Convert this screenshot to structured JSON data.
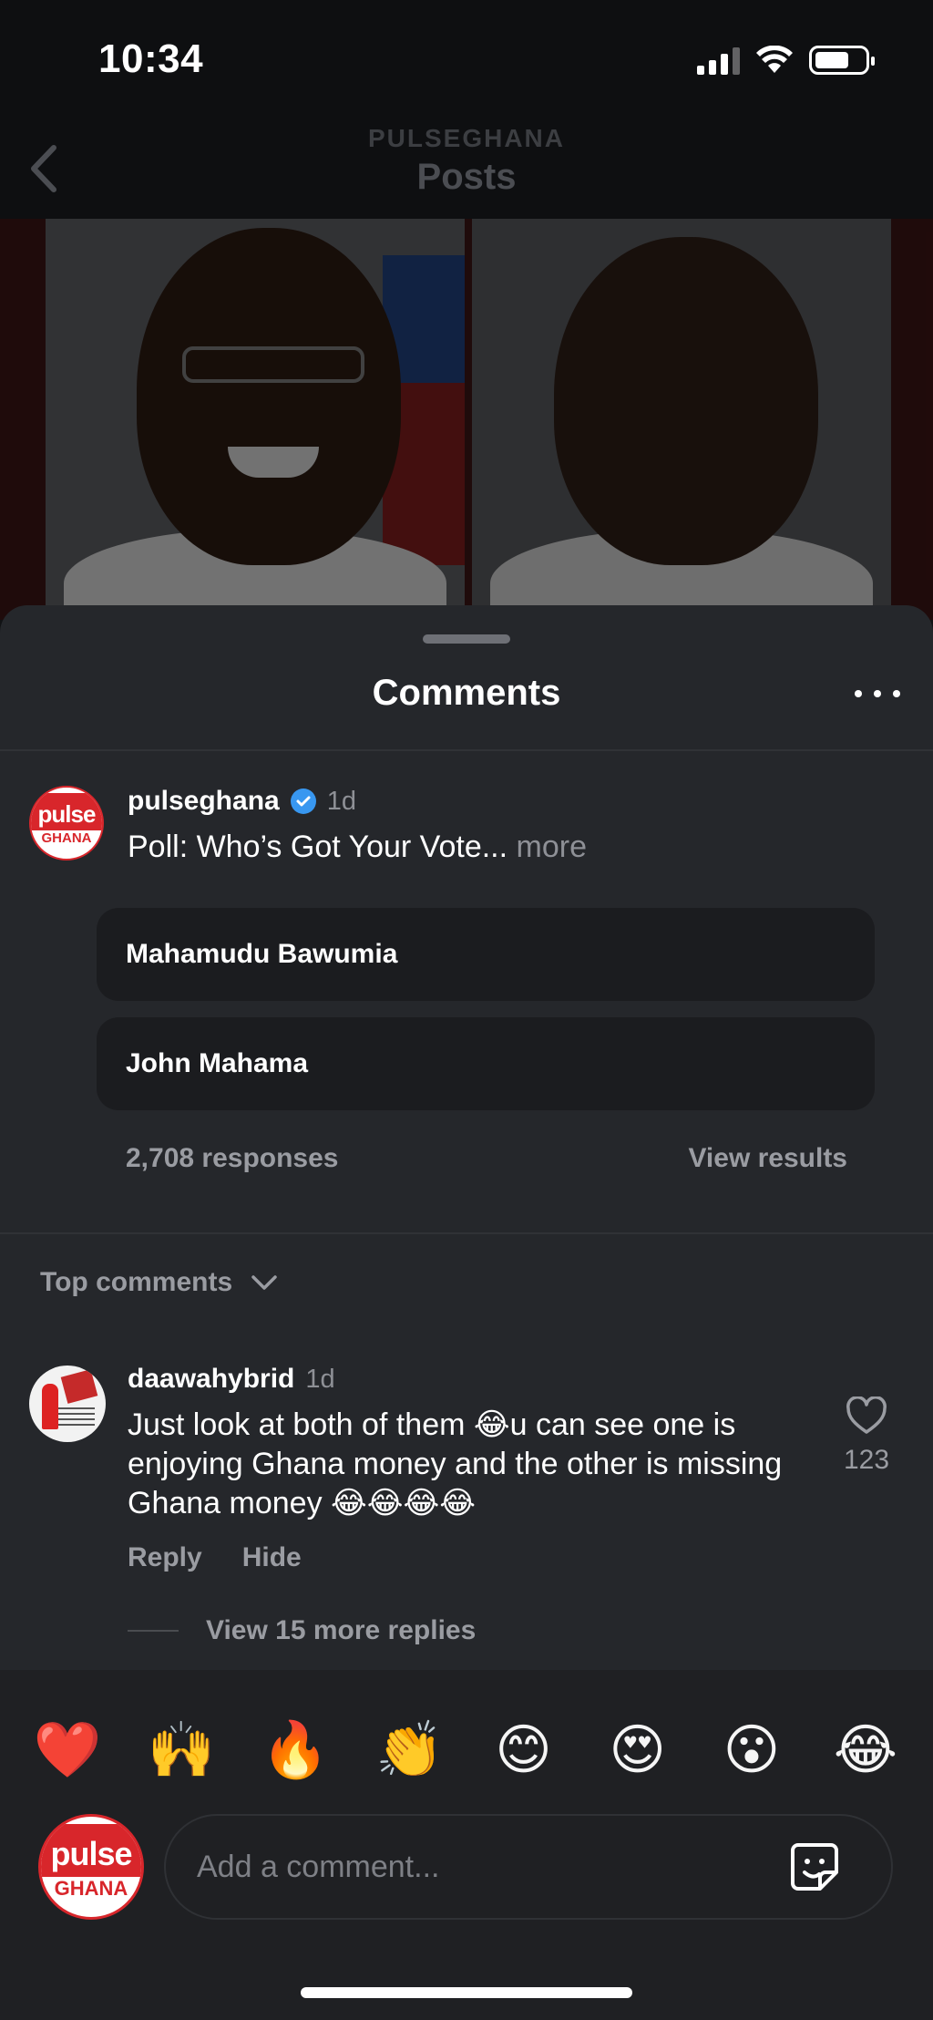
{
  "status_bar": {
    "time": "10:34"
  },
  "header": {
    "subtitle": "PULSEGHANA",
    "title": "Posts"
  },
  "sheet": {
    "title": "Comments"
  },
  "post": {
    "author": "pulseghana",
    "time_ago": "1d",
    "caption": "Poll: Who’s Got Your Vote...",
    "caption_more": "more",
    "avatar": {
      "brand_top": "pulse",
      "brand_bottom": "GHANA"
    }
  },
  "poll": {
    "options": [
      "Mahamudu Bawumia",
      "John Mahama"
    ],
    "responses": "2,708 responses",
    "view_results": "View results"
  },
  "sort": {
    "label": "Top comments"
  },
  "comment": {
    "author": "daawahybrid",
    "time_ago": "1d",
    "text": "Just look at both of them 😂u can see one is enjoying Ghana money and the other is missing Ghana money 😂😂😂😂",
    "likes": "123",
    "reply_label": "Reply",
    "hide_label": "Hide",
    "view_replies": "View 15 more replies"
  },
  "reactions": [
    "❤️",
    "🙌",
    "🔥",
    "👏",
    "😊",
    "😍",
    "😮",
    "😂"
  ],
  "input": {
    "placeholder": "Add a comment..."
  },
  "colors": {
    "brand_red": "#d8262b",
    "verified_blue": "#3897f0",
    "sheet_bg": "#25272b"
  }
}
